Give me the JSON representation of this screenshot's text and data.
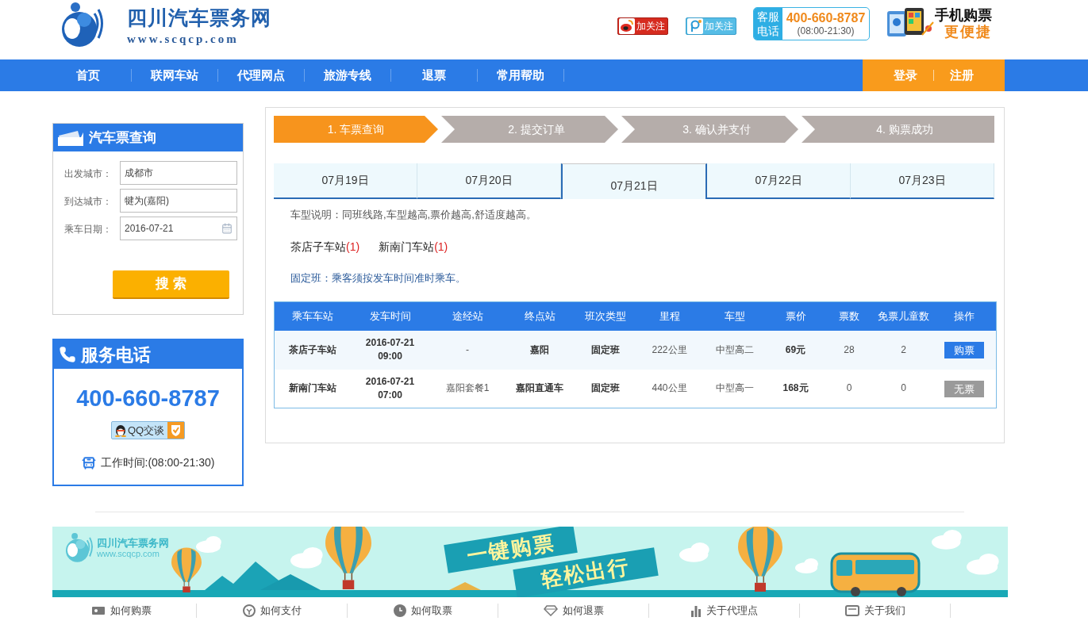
{
  "header": {
    "site_title": "四川汽车票务网",
    "site_url": "www.scqcp.com",
    "follow_buttons": [
      {
        "kind": "weibo",
        "label": "加关注"
      },
      {
        "kind": "tencent_weibo",
        "label": "加关注"
      }
    ],
    "hotline": {
      "label": [
        "客服",
        "电话"
      ],
      "number": "400-660-8787",
      "hours": "(08:00-21:30)"
    },
    "mobile_promo": {
      "line_1": "手机购票",
      "line_2": "更便捷"
    }
  },
  "nav": {
    "items": [
      "首页",
      "联网车站",
      "代理网点",
      "旅游专线",
      "退票",
      "常用帮助"
    ],
    "login": "登录",
    "register": "注册"
  },
  "search_panel": {
    "title": "汽车票查询",
    "fields": [
      {
        "kind": "text",
        "label": "出发城市：",
        "value": "成都市"
      },
      {
        "kind": "text",
        "label": "到达城市：",
        "value": "犍为(嘉阳)"
      },
      {
        "kind": "date",
        "label": "乘车日期：",
        "value": "2016-07-21"
      }
    ],
    "button": "搜 索"
  },
  "service_panel": {
    "title": "服务电话",
    "phone": "400-660-8787",
    "qq_button": "QQ交谈",
    "hours": "工作时间:(08:00-21:30)"
  },
  "steps": [
    {
      "label": "1. 车票查询",
      "selected": true
    },
    {
      "label": "2. 提交订单",
      "selected": false
    },
    {
      "label": "3. 确认并支付",
      "selected": false
    },
    {
      "label": "4. 购票成功",
      "selected": false
    }
  ],
  "date_tabs": [
    {
      "label": "07月19日",
      "selected": false
    },
    {
      "label": "07月20日",
      "selected": false
    },
    {
      "label": "07月21日",
      "selected": true
    },
    {
      "label": "07月22日",
      "selected": false
    },
    {
      "label": "07月23日",
      "selected": false
    }
  ],
  "bus_type_note": "车型说明：同班线路,车型越高,票价越高,舒适度越高。",
  "stations": [
    {
      "name": "茶店子车站",
      "count": "(1)"
    },
    {
      "name": "新南门车站",
      "count": "(1)"
    }
  ],
  "schedule_note": "固定班：乘客须按发车时间准时乘车。",
  "table": {
    "columns": [
      "乘车车站",
      "发车时间",
      "途经站",
      "终点站",
      "班次类型",
      "里程",
      "车型",
      "票价",
      "票数",
      "免票儿童数",
      "操作"
    ],
    "rows": [
      {
        "station": "茶店子车站",
        "date": "2016-07-21",
        "time": "09:00",
        "via": "-",
        "terminal": "嘉阳",
        "service_type": "固定班",
        "distance": "222公里",
        "bus_type": "中型高二",
        "price": "69元",
        "tickets": "28",
        "free_children": "2",
        "action": {
          "label": "购票",
          "disabled": false
        }
      },
      {
        "station": "新南门车站",
        "date": "2016-07-21",
        "time": "07:00",
        "via": "嘉阳套餐1",
        "terminal": "嘉阳直通车",
        "service_type": "固定班",
        "distance": "440公里",
        "bus_type": "中型高一",
        "price": "168元",
        "tickets": "0",
        "free_children": "0",
        "action": {
          "label": "无票",
          "disabled": true
        }
      }
    ]
  },
  "banner": {
    "logo_title": "四川汽车票务网",
    "logo_url": "www.scqcp.com",
    "slogans": [
      "一键购票",
      "轻松出行"
    ]
  },
  "footer_links": [
    {
      "kind": "buy",
      "label": "如何购票"
    },
    {
      "kind": "pay",
      "label": "如何支付"
    },
    {
      "kind": "collect",
      "label": "如何取票"
    },
    {
      "kind": "refund",
      "label": "如何退票"
    },
    {
      "kind": "agent",
      "label": "关于代理点"
    },
    {
      "kind": "about",
      "label": "关于我们"
    }
  ]
}
